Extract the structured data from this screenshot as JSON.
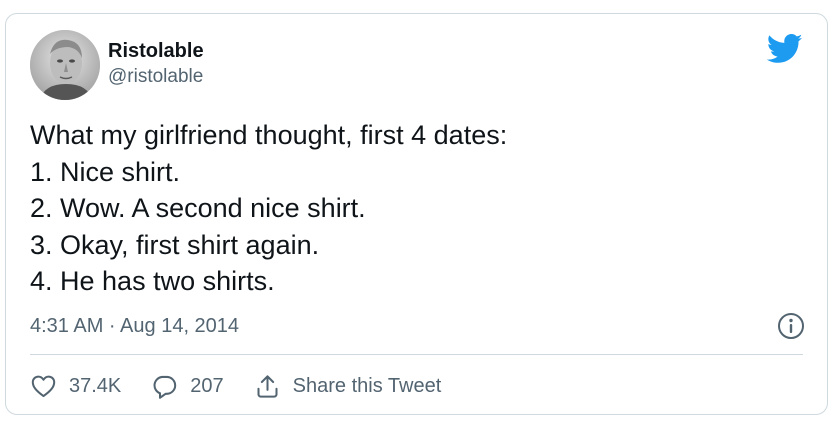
{
  "author": {
    "display_name": "Ristolable",
    "handle": "@ristolable",
    "avatar_icon": "portrait-avatar"
  },
  "tweet": {
    "lines": [
      "What my girlfriend thought, first 4 dates:",
      "1. Nice shirt.",
      "2. Wow. A second nice shirt.",
      "3. Okay, first shirt again.",
      "4. He has two shirts."
    ],
    "timestamp": "4:31 AM · Aug 14, 2014"
  },
  "actions": {
    "likes": "37.4K",
    "replies": "207",
    "share_label": "Share this Tweet"
  },
  "icons": {
    "brand": "twitter-bird-icon",
    "info": "info-icon",
    "like": "heart-icon",
    "reply": "reply-bubble-icon",
    "share": "share-icon"
  },
  "colors": {
    "brand": "#1d9bf0",
    "text": "#0f1419",
    "secondary_text": "#536471",
    "border": "#cfd9de"
  }
}
